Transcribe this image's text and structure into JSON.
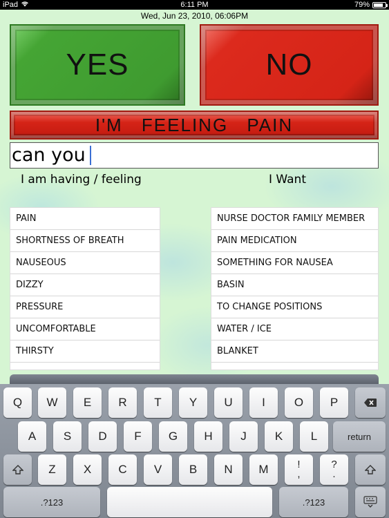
{
  "status_bar": {
    "carrier": "iPad",
    "time": "6:11 PM",
    "battery_text": "79%",
    "battery_level": 0.79
  },
  "datetime": "Wed, Jun 23, 2010, 06:06PM",
  "buttons": {
    "yes": "YES",
    "no": "NO",
    "pain": "I'M FEELING PAIN"
  },
  "input": {
    "value": "can you"
  },
  "headings": {
    "feeling": "I am having / feeling",
    "want": "I Want"
  },
  "feeling_list": [
    "PAIN",
    "SHORTNESS OF BREATH",
    "NAUSEOUS",
    "DIZZY",
    "PRESSURE",
    "UNCOMFORTABLE",
    "THIRSTY"
  ],
  "want_list": [
    "NURSE DOCTOR FAMILY MEMBER",
    "PAIN MEDICATION",
    "SOMETHING FOR NAUSEA",
    "BASIN",
    "TO CHANGE POSITIONS",
    "WATER / ICE",
    "BLANKET"
  ],
  "keyboard": {
    "row1": [
      "Q",
      "W",
      "E",
      "R",
      "T",
      "Y",
      "U",
      "I",
      "O",
      "P"
    ],
    "row2": [
      "A",
      "S",
      "D",
      "F",
      "G",
      "H",
      "J",
      "K",
      "L"
    ],
    "row3": [
      "Z",
      "X",
      "C",
      "V",
      "B",
      "N",
      "M"
    ],
    "return_label": "return",
    "numbers_label": ".?123",
    "punct1": [
      "!",
      ","
    ],
    "punct2": [
      "?",
      "."
    ]
  },
  "colors": {
    "yes": "#45a534",
    "no": "#d52417",
    "background": "#d6f5d3"
  }
}
